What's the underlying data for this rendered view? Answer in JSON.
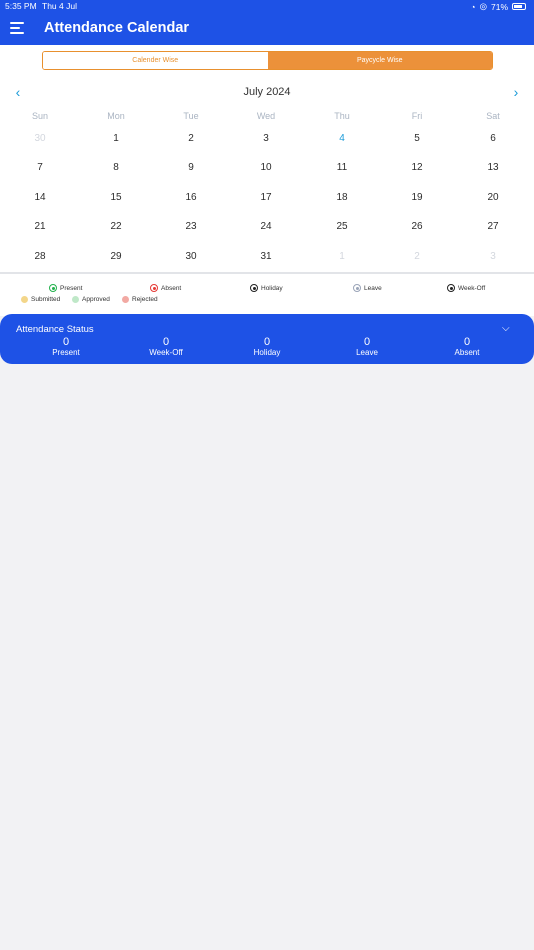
{
  "status_bar": {
    "time": "5:35 PM",
    "date": "Thu 4 Jul",
    "battery": "71%"
  },
  "app_bar": {
    "title": "Attendance Calendar"
  },
  "view_toggle": {
    "calendar_wise": "Calender Wise",
    "paycycle_wise": "Paycycle Wise",
    "selected": "paycycle_wise"
  },
  "calendar": {
    "month_label": "July 2024",
    "weekdays": [
      "Sun",
      "Mon",
      "Tue",
      "Wed",
      "Thu",
      "Fri",
      "Sat"
    ],
    "weeks": [
      [
        {
          "d": "30",
          "muted": true
        },
        {
          "d": "1"
        },
        {
          "d": "2"
        },
        {
          "d": "3"
        },
        {
          "d": "4",
          "today": true
        },
        {
          "d": "5"
        },
        {
          "d": "6"
        }
      ],
      [
        {
          "d": "7"
        },
        {
          "d": "8"
        },
        {
          "d": "9"
        },
        {
          "d": "10"
        },
        {
          "d": "11"
        },
        {
          "d": "12"
        },
        {
          "d": "13"
        }
      ],
      [
        {
          "d": "14"
        },
        {
          "d": "15"
        },
        {
          "d": "16"
        },
        {
          "d": "17"
        },
        {
          "d": "18"
        },
        {
          "d": "19"
        },
        {
          "d": "20"
        }
      ],
      [
        {
          "d": "21"
        },
        {
          "d": "22"
        },
        {
          "d": "23"
        },
        {
          "d": "24"
        },
        {
          "d": "25"
        },
        {
          "d": "26"
        },
        {
          "d": "27"
        }
      ],
      [
        {
          "d": "28"
        },
        {
          "d": "29"
        },
        {
          "d": "30"
        },
        {
          "d": "31"
        },
        {
          "d": "1",
          "muted": true
        },
        {
          "d": "2",
          "muted": true
        },
        {
          "d": "3",
          "muted": true
        }
      ]
    ]
  },
  "legend": {
    "present": "Present",
    "absent": "Absent",
    "holiday": "Holiday",
    "leave": "Leave",
    "week_off": "Week-Off",
    "submitted": "Submitted",
    "approved": "Approved",
    "rejected": "Rejected",
    "colors": {
      "present": "#22b14c",
      "absent": "#e53935",
      "holiday": "#222222",
      "leave": "#9aa4b8",
      "week_off": "#222222",
      "submitted": "#f3d68a",
      "approved": "#bfe8c8",
      "rejected": "#f2a9a3"
    }
  },
  "attendance_status": {
    "title": "Attendance Status",
    "stats": [
      {
        "value": "0",
        "label": "Present"
      },
      {
        "value": "0",
        "label": "Week-Off"
      },
      {
        "value": "0",
        "label": "Holiday"
      },
      {
        "value": "0",
        "label": "Leave"
      },
      {
        "value": "0",
        "label": "Absent"
      }
    ]
  },
  "colors": {
    "primary": "#1e52e6",
    "accent": "#ec913a",
    "today": "#1a9bd8",
    "background": "#f2f2f4"
  }
}
